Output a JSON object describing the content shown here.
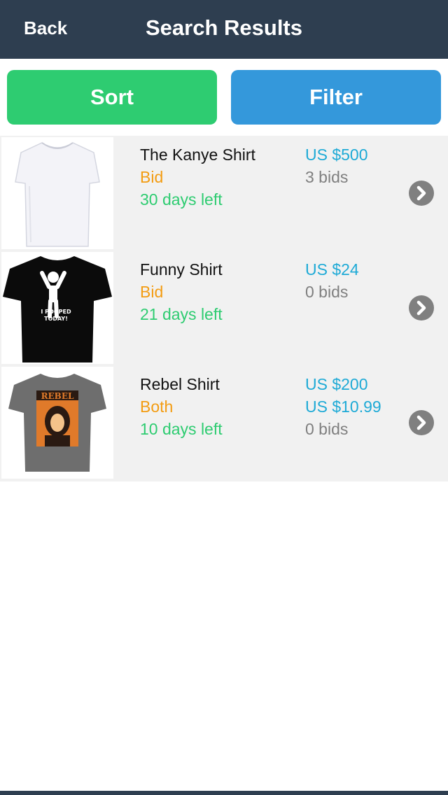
{
  "header": {
    "back_label": "Back",
    "title": "Search Results"
  },
  "toolbar": {
    "sort_label": "Sort",
    "filter_label": "Filter"
  },
  "colors": {
    "nav_bar": "#2e3e50",
    "sort_button": "#2ecc71",
    "filter_button": "#3498db",
    "listing_type": "#f39c12",
    "time_left": "#2ecc71",
    "price": "#1eaad6",
    "bids": "#7f7f7f"
  },
  "results": [
    {
      "title": "The Kanye Shirt",
      "type": "Bid",
      "time_left": "30 days left",
      "price": "US $500",
      "bids": "3 bids",
      "image_icon": "white-tshirt-icon"
    },
    {
      "title": "Funny Shirt",
      "type": "Bid",
      "time_left": "21 days left",
      "price": "US $24",
      "bids": "0 bids",
      "image_icon": "black-tshirt-icon",
      "shirt_print": "I POOPED TODAY!"
    },
    {
      "title": "Rebel Shirt",
      "type": "Both",
      "time_left": "10 days left",
      "price": "US $200",
      "buy_price": "US $10.99",
      "bids": "0 bids",
      "image_icon": "gray-tshirt-icon",
      "shirt_print": "REBEL"
    }
  ]
}
